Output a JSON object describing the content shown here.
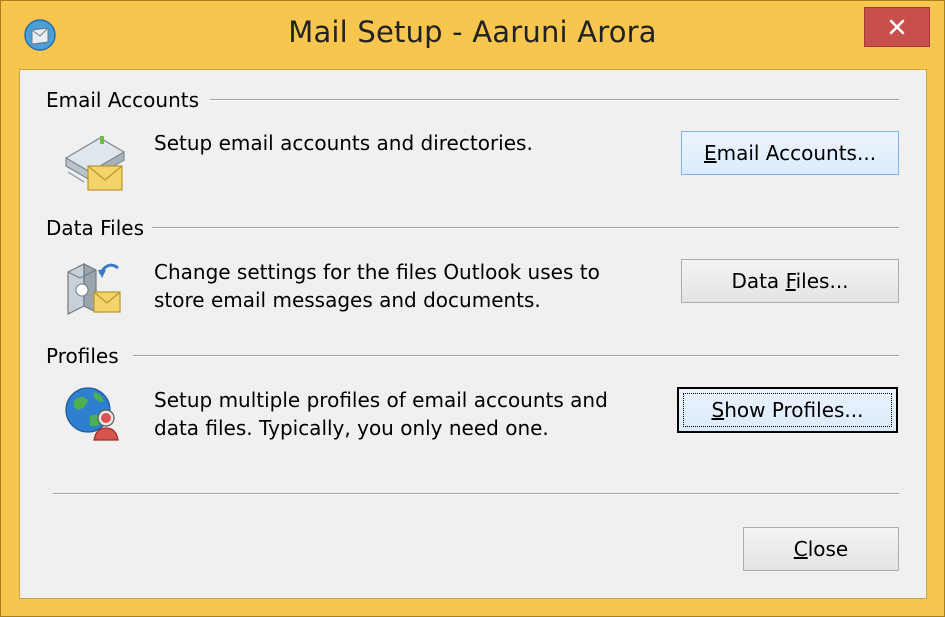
{
  "window": {
    "title": "Mail Setup - Aaruni Arora",
    "close_glyph": "✕",
    "app_icon": "mail-setup-icon",
    "frame_color": "#f7c64f",
    "close_color": "#c7504d"
  },
  "groups": {
    "email": {
      "label": "Email Accounts",
      "icon": "email-accounts-icon",
      "description": "Setup email accounts and directories.",
      "button": {
        "pre": "",
        "accel": "E",
        "post": "mail Accounts..."
      }
    },
    "data": {
      "label": "Data Files",
      "icon": "data-files-icon",
      "description_line1": "Change settings for the files Outlook uses to",
      "description_line2": "store email messages and documents.",
      "button": {
        "pre": "Data ",
        "accel": "F",
        "post": "iles..."
      }
    },
    "profiles": {
      "label": "Profiles",
      "icon": "profiles-globe-icon",
      "description_line1": "Setup multiple profiles of email accounts and",
      "description_line2": "data files. Typically, you only need one.",
      "button": {
        "pre": "",
        "accel": "S",
        "post": "how Profiles..."
      }
    }
  },
  "footer": {
    "close_button": {
      "pre": "",
      "accel": "C",
      "post": "lose"
    }
  }
}
